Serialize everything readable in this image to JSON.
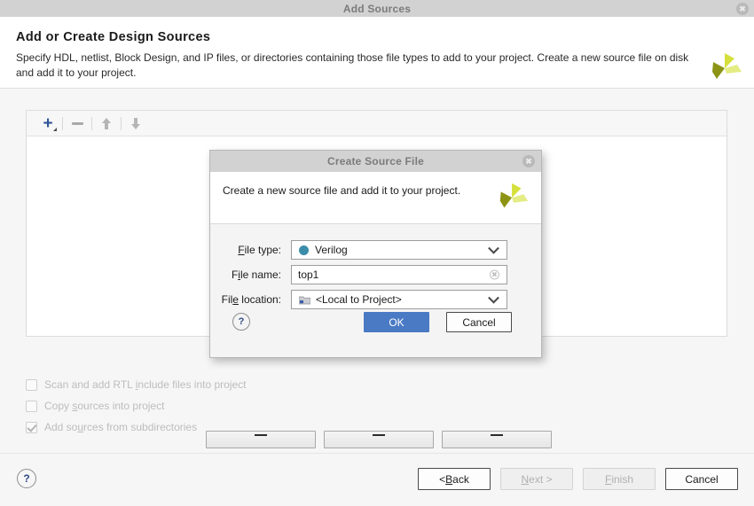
{
  "window": {
    "title": "Add Sources",
    "close_icon": "close-icon"
  },
  "banner": {
    "title": "Add or Create Design Sources",
    "description": "Specify HDL, netlist, Block Design, and IP files, or directories containing those file types to add to your project. Create a new source file on disk and add it to your project.",
    "logo": "xilinx-logo"
  },
  "toolbar": {
    "add_label": "+",
    "remove_label": "−",
    "move_up_icon": "arrow-up-icon",
    "move_down_icon": "arrow-down-icon"
  },
  "options": [
    {
      "label_pre": "Scan and add RTL ",
      "accel": "i",
      "label_post": "nclude files into project",
      "checked": false
    },
    {
      "label_pre": "Copy ",
      "accel": "s",
      "label_post": "ources into project",
      "checked": false
    },
    {
      "label_pre": "Add so",
      "accel": "u",
      "label_post": "rces from subdirectories",
      "checked": true
    }
  ],
  "footer": {
    "help_label": "?",
    "buttons": [
      {
        "pre": "< ",
        "accel": "B",
        "post": "ack",
        "state": "enabled"
      },
      {
        "pre": "",
        "accel": "N",
        "post": "ext >",
        "state": "disabled"
      },
      {
        "pre": "",
        "accel": "F",
        "post": "inish",
        "state": "disabled"
      },
      {
        "pre": "",
        "accel": "C",
        "post": "ancel",
        "state": "enabled"
      }
    ]
  },
  "modal": {
    "title": "Create Source File",
    "close_icon": "close-icon",
    "description": "Create a new source file and add it to your project.",
    "logo": "xilinx-logo",
    "fields": {
      "file_type": {
        "label_pre": "",
        "label_accel": "F",
        "label_post": "ile type:",
        "value": "Verilog",
        "dot_color": "#3c8da9"
      },
      "file_name": {
        "label_pre": "F",
        "label_accel": "i",
        "label_post": "le name:",
        "value": "top1",
        "placeholder": "",
        "clear_icon": "clear-icon"
      },
      "file_location": {
        "label_pre": "Fil",
        "label_accel": "e",
        "label_post": " location:",
        "value": "<Local to Project>",
        "folder_icon": "folder-icon"
      }
    },
    "help_label": "?",
    "ok_label": "OK",
    "cancel_label": "Cancel",
    "ok_color": "#4a7ac4"
  }
}
